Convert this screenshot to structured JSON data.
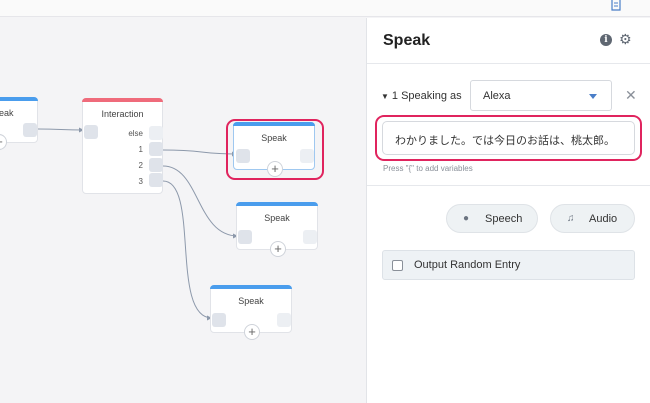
{
  "canvas": {
    "left_partial_node": {
      "title": "eak"
    },
    "interaction_node": {
      "title": "Interaction",
      "choices": [
        "else",
        "1",
        "2",
        "3"
      ]
    },
    "speak_nodes": [
      {
        "title": "Speak"
      },
      {
        "title": "Speak"
      },
      {
        "title": "Speak"
      }
    ],
    "plus_glyph": "+"
  },
  "panel": {
    "title": "Speak",
    "speaking_label": "1 Speaking as",
    "voice_value": "Alexa",
    "text_value": "わかりました。では今日のお話は、桃太郎。",
    "hint": "Press \"{\" to add variables",
    "speech_button": "Speech",
    "audio_button": "Audio",
    "random_entry_label": "Output Random Entry"
  },
  "colors": {
    "highlight": "#e0245e",
    "node_bar_speak": "#4a9ded",
    "node_bar_interaction": "#ef6b7b",
    "select_arrow": "#4a7ec8"
  },
  "icons": [
    "document-icon",
    "info-icon",
    "gear-icon",
    "close-icon",
    "chat-icon",
    "music-note-icon",
    "chevron-down-icon"
  ]
}
